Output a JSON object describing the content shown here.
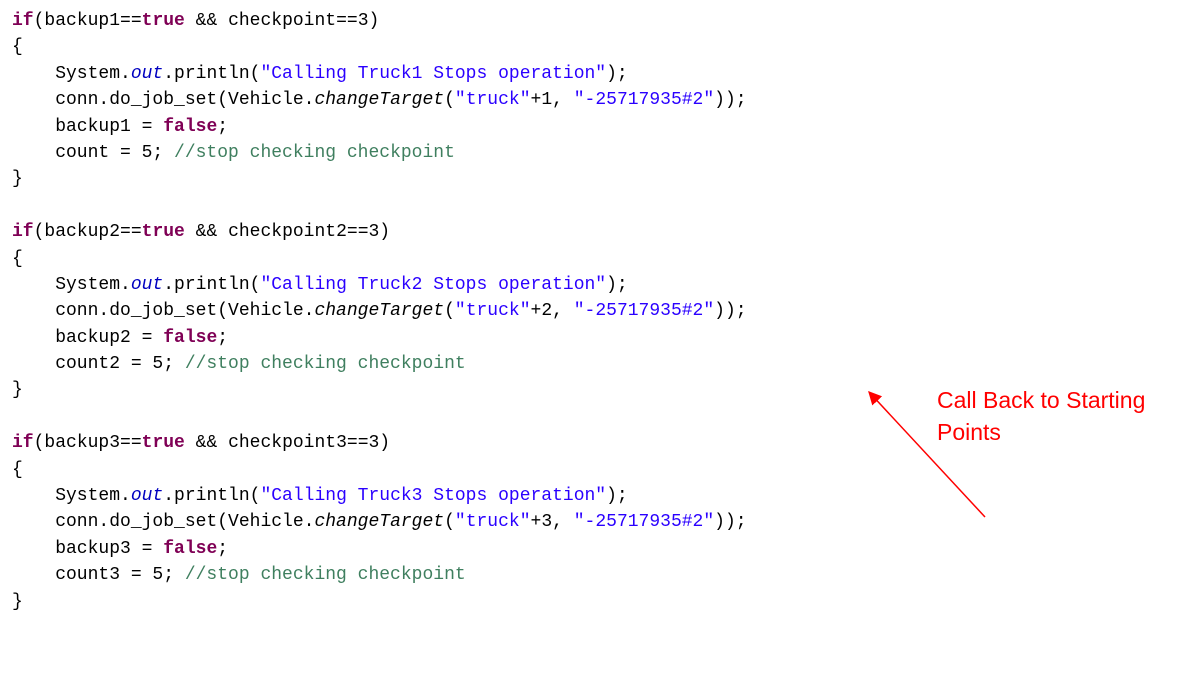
{
  "code_lines": [
    [
      {
        "t": "if",
        "c": "kw"
      },
      {
        "t": "(backup1==",
        "c": "plain"
      },
      {
        "t": "true",
        "c": "kw"
      },
      {
        "t": " && checkpoint==3)",
        "c": "plain"
      }
    ],
    [
      {
        "t": "{",
        "c": "plain"
      }
    ],
    [
      {
        "t": "    System.",
        "c": "plain"
      },
      {
        "t": "out",
        "c": "field"
      },
      {
        "t": ".println(",
        "c": "plain"
      },
      {
        "t": "\"Calling Truck1 Stops operation\"",
        "c": "str"
      },
      {
        "t": ");",
        "c": "plain"
      }
    ],
    [
      {
        "t": "    conn.do_job_set(Vehicle.",
        "c": "plain"
      },
      {
        "t": "changeTarget",
        "c": "method"
      },
      {
        "t": "(",
        "c": "plain"
      },
      {
        "t": "\"truck\"",
        "c": "str"
      },
      {
        "t": "+1, ",
        "c": "plain"
      },
      {
        "t": "\"-25717935#2\"",
        "c": "str"
      },
      {
        "t": "));",
        "c": "plain"
      }
    ],
    [
      {
        "t": "    backup1 = ",
        "c": "plain"
      },
      {
        "t": "false",
        "c": "kw"
      },
      {
        "t": ";",
        "c": "plain"
      }
    ],
    [
      {
        "t": "    count = 5; ",
        "c": "plain"
      },
      {
        "t": "//stop checking checkpoint",
        "c": "comment"
      }
    ],
    [
      {
        "t": "}",
        "c": "plain"
      }
    ],
    [],
    [
      {
        "t": "if",
        "c": "kw"
      },
      {
        "t": "(backup2==",
        "c": "plain"
      },
      {
        "t": "true",
        "c": "kw"
      },
      {
        "t": " && checkpoint2==3)",
        "c": "plain"
      }
    ],
    [
      {
        "t": "{",
        "c": "plain"
      }
    ],
    [
      {
        "t": "    System.",
        "c": "plain"
      },
      {
        "t": "out",
        "c": "field"
      },
      {
        "t": ".println(",
        "c": "plain"
      },
      {
        "t": "\"Calling Truck2 Stops operation\"",
        "c": "str"
      },
      {
        "t": ");",
        "c": "plain"
      }
    ],
    [
      {
        "t": "    conn.do_job_set(Vehicle.",
        "c": "plain"
      },
      {
        "t": "changeTarget",
        "c": "method"
      },
      {
        "t": "(",
        "c": "plain"
      },
      {
        "t": "\"truck\"",
        "c": "str"
      },
      {
        "t": "+2, ",
        "c": "plain"
      },
      {
        "t": "\"-25717935#2\"",
        "c": "str"
      },
      {
        "t": "));",
        "c": "plain"
      }
    ],
    [
      {
        "t": "    backup2 = ",
        "c": "plain"
      },
      {
        "t": "false",
        "c": "kw"
      },
      {
        "t": ";",
        "c": "plain"
      }
    ],
    [
      {
        "t": "    count2 = 5; ",
        "c": "plain"
      },
      {
        "t": "//stop checking checkpoint",
        "c": "comment"
      }
    ],
    [
      {
        "t": "}",
        "c": "plain"
      }
    ],
    [],
    [
      {
        "t": "if",
        "c": "kw"
      },
      {
        "t": "(backup3==",
        "c": "plain"
      },
      {
        "t": "true",
        "c": "kw"
      },
      {
        "t": " && checkpoint3==3)",
        "c": "plain"
      }
    ],
    [
      {
        "t": "{",
        "c": "plain"
      }
    ],
    [
      {
        "t": "    System.",
        "c": "plain"
      },
      {
        "t": "out",
        "c": "field"
      },
      {
        "t": ".println(",
        "c": "plain"
      },
      {
        "t": "\"Calling Truck3 Stops operation\"",
        "c": "str"
      },
      {
        "t": ");",
        "c": "plain"
      }
    ],
    [
      {
        "t": "    conn.do_job_set(Vehicle.",
        "c": "plain"
      },
      {
        "t": "changeTarget",
        "c": "method"
      },
      {
        "t": "(",
        "c": "plain"
      },
      {
        "t": "\"truck\"",
        "c": "str"
      },
      {
        "t": "+3, ",
        "c": "plain"
      },
      {
        "t": "\"-25717935#2\"",
        "c": "str"
      },
      {
        "t": "));",
        "c": "plain"
      }
    ],
    [
      {
        "t": "    backup3 = ",
        "c": "plain"
      },
      {
        "t": "false",
        "c": "kw"
      },
      {
        "t": ";",
        "c": "plain"
      }
    ],
    [
      {
        "t": "    count3 = 5; ",
        "c": "plain"
      },
      {
        "t": "//stop checking checkpoint",
        "c": "comment"
      }
    ],
    [
      {
        "t": "}",
        "c": "plain"
      }
    ]
  ],
  "annotation": {
    "text": "Call Back to Starting Points",
    "color": "#ff0000"
  },
  "syntax_colors": {
    "keyword": "#7f0055",
    "string": "#2a00ff",
    "static_field": "#0000c0",
    "comment": "#3f7f5f",
    "plain": "#000000"
  }
}
